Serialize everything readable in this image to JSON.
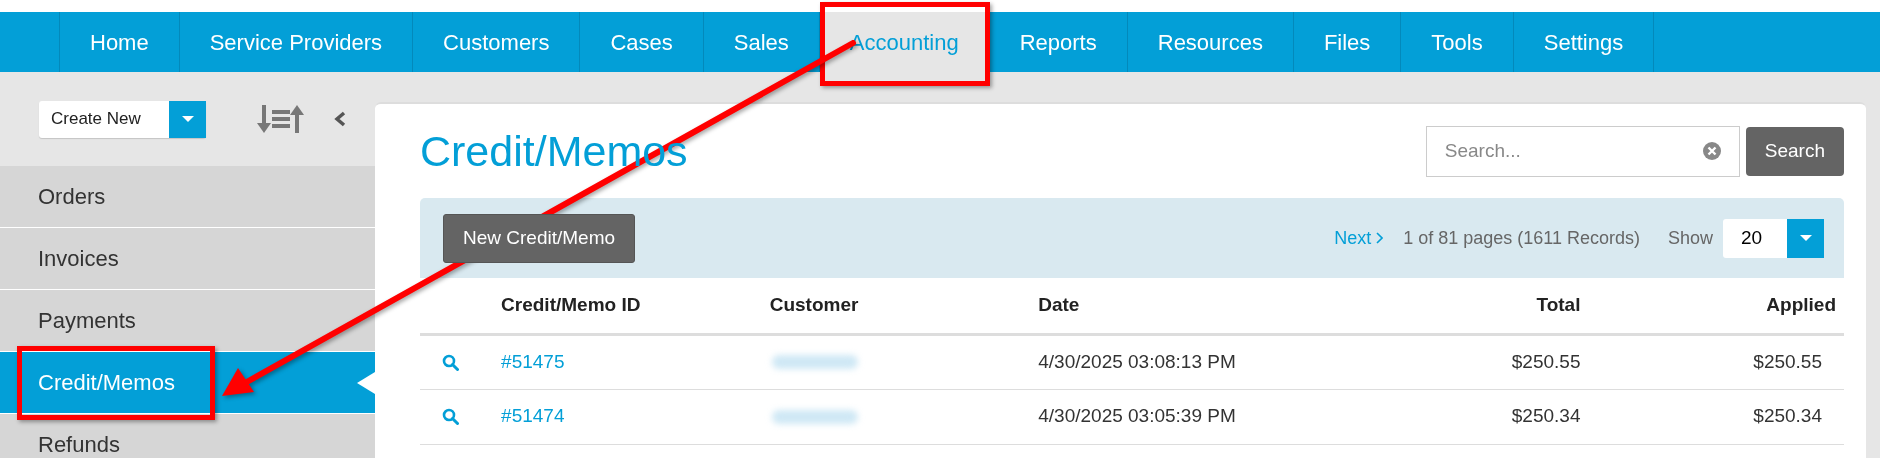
{
  "nav": {
    "tabs": [
      {
        "label": "Home",
        "selected": false,
        "highlighted": false
      },
      {
        "label": "Service Providers",
        "selected": false,
        "highlighted": false
      },
      {
        "label": "Customers",
        "selected": false,
        "highlighted": false
      },
      {
        "label": "Cases",
        "selected": false,
        "highlighted": false
      },
      {
        "label": "Sales",
        "selected": false,
        "highlighted": false
      },
      {
        "label": "Accounting",
        "selected": true,
        "highlighted": true
      },
      {
        "label": "Reports",
        "selected": false,
        "highlighted": false
      },
      {
        "label": "Resources",
        "selected": false,
        "highlighted": false
      },
      {
        "label": "Files",
        "selected": false,
        "highlighted": false
      },
      {
        "label": "Tools",
        "selected": false,
        "highlighted": false
      },
      {
        "label": "Settings",
        "selected": false,
        "highlighted": false
      }
    ]
  },
  "sidebar": {
    "create_button": "Create New",
    "items": [
      {
        "label": "Orders",
        "selected": false,
        "highlighted": false
      },
      {
        "label": "Invoices",
        "selected": false,
        "highlighted": false
      },
      {
        "label": "Payments",
        "selected": false,
        "highlighted": false
      },
      {
        "label": "Credit/Memos",
        "selected": true,
        "highlighted": true
      },
      {
        "label": "Refunds",
        "selected": false,
        "highlighted": false
      }
    ]
  },
  "page": {
    "title": "Credit/Memos",
    "search": {
      "placeholder": "Search...",
      "button": "Search"
    },
    "new_button": "New Credit/Memo",
    "pagination": {
      "next": "Next",
      "summary": "1 of 81 pages (1611 Records)",
      "show_label": "Show",
      "page_size": "20"
    }
  },
  "table": {
    "columns": [
      "Credit/Memo ID",
      "Customer",
      "Date",
      "Total",
      "Applied"
    ],
    "rows": [
      {
        "id": "#51475",
        "date": "4/30/2025 03:08:13 PM",
        "total": "$250.55",
        "applied": "$250.55"
      },
      {
        "id": "#51474",
        "date": "4/30/2025 03:05:39 PM",
        "total": "$250.34",
        "applied": "$250.34"
      }
    ]
  }
}
